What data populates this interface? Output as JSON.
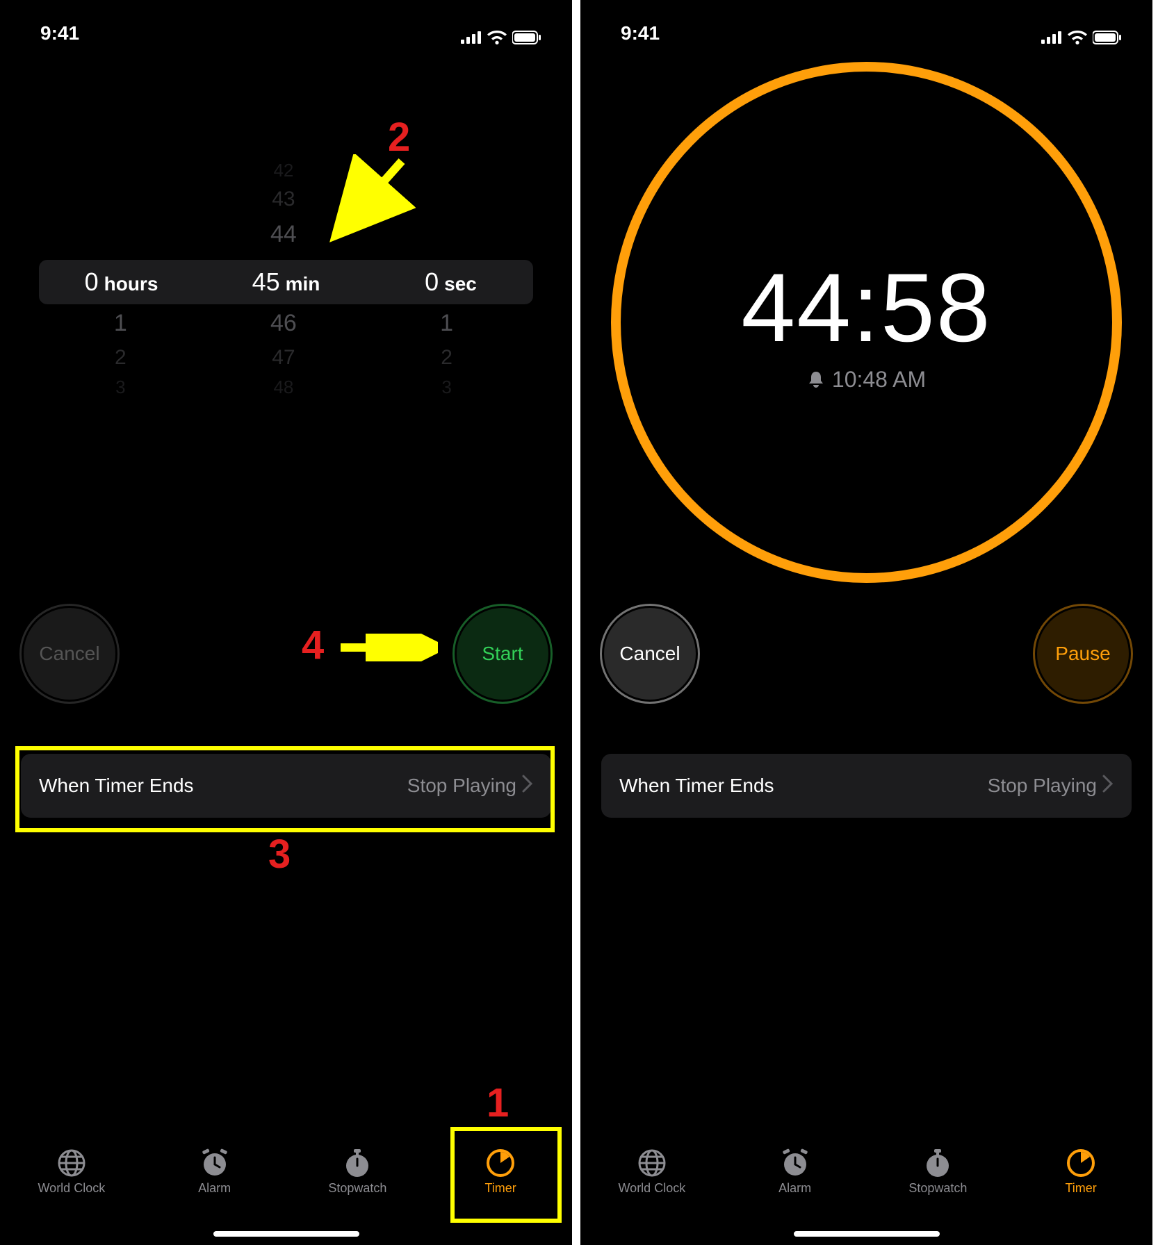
{
  "status": {
    "time": "9:41"
  },
  "colors": {
    "accent": "#ff9f0a",
    "start": "#33d158",
    "pause": "#ff9f0a"
  },
  "left": {
    "picker": {
      "hours_value": "0",
      "hours_label": "hours",
      "min_value": "45",
      "min_label": "min",
      "sec_value": "0",
      "sec_label": "sec",
      "hours_ghost_below": [
        "1",
        "2",
        "3"
      ],
      "min_ghost_above": [
        "44",
        "43",
        "42"
      ],
      "min_ghost_below": [
        "46",
        "47",
        "48"
      ],
      "sec_ghost_below": [
        "1",
        "2",
        "3"
      ]
    },
    "cancel_label": "Cancel",
    "start_label": "Start",
    "ends": {
      "label": "When Timer Ends",
      "value": "Stop Playing"
    }
  },
  "right": {
    "countdown_time": "44:58",
    "end_time": "10:48 AM",
    "cancel_label": "Cancel",
    "pause_label": "Pause",
    "ends": {
      "label": "When Timer Ends",
      "value": "Stop Playing"
    }
  },
  "tabs": [
    {
      "label": "World Clock"
    },
    {
      "label": "Alarm"
    },
    {
      "label": "Stopwatch"
    },
    {
      "label": "Timer"
    }
  ],
  "annotations": {
    "n1": "1",
    "n2": "2",
    "n3": "3",
    "n4": "4"
  }
}
